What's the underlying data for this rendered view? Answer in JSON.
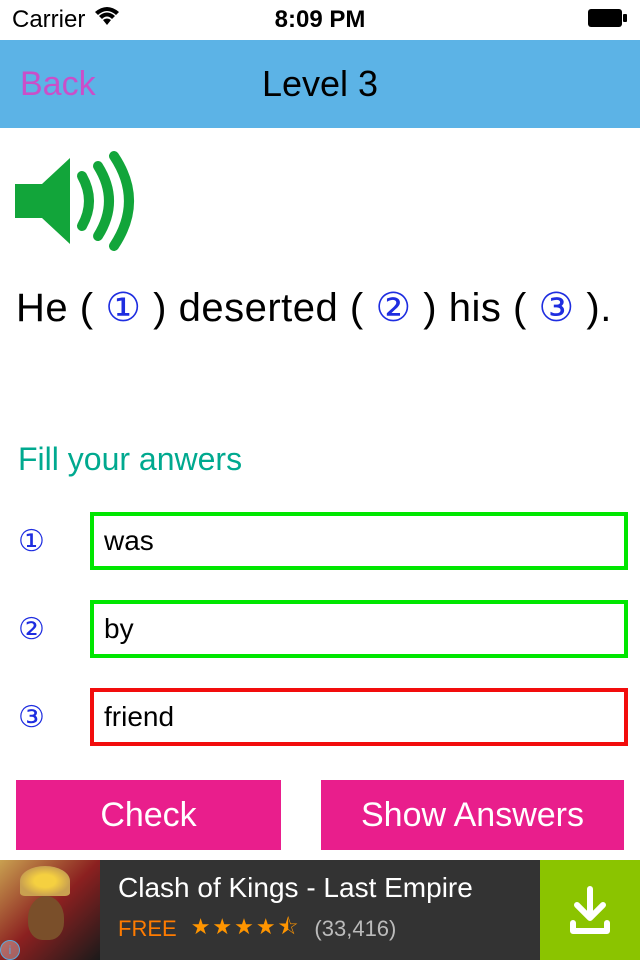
{
  "status": {
    "carrier": "Carrier",
    "time": "8:09 PM"
  },
  "nav": {
    "back": "Back",
    "title": "Level 3"
  },
  "question": {
    "p1": "He ( ",
    "b1": "①",
    "p2": "  ) deserted ( ",
    "b2": "②",
    "p3": "  ) his ( ",
    "b3": "③",
    "p4": "  )."
  },
  "answers": {
    "title": "Fill your anwers",
    "rows": [
      {
        "num": "①",
        "value": "was",
        "state": "correct"
      },
      {
        "num": "②",
        "value": "by",
        "state": "correct"
      },
      {
        "num": "③",
        "value": "friend",
        "state": "wrong"
      }
    ]
  },
  "buttons": {
    "check": "Check",
    "show": "Show Answers"
  },
  "ad": {
    "title": "Clash of Kings - Last Empire",
    "free": "FREE",
    "stars": "★★★★⯪",
    "count": "(33,416)",
    "badge": "i"
  },
  "colors": {
    "navbar": "#5cb3e6",
    "back": "#c94fc9",
    "circled": "#1e2de0",
    "answers_title": "#00a98f",
    "correct_border": "#00e600",
    "wrong_border": "#f20d0d",
    "button": "#e91e8c",
    "download": "#8bc400"
  }
}
